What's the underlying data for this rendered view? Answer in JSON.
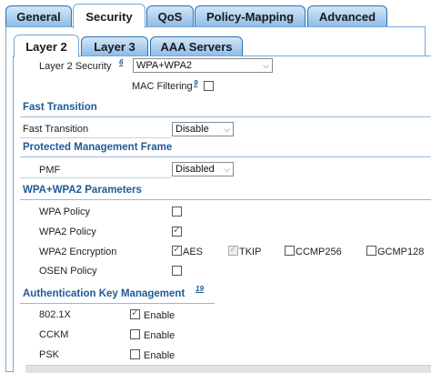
{
  "outer_tabs": [
    {
      "label": "General"
    },
    {
      "label": "Security",
      "active": true
    },
    {
      "label": "QoS"
    },
    {
      "label": "Policy-Mapping"
    },
    {
      "label": "Advanced"
    }
  ],
  "inner_tabs": [
    {
      "label": "Layer 2",
      "active": true
    },
    {
      "label": "Layer 3"
    },
    {
      "label": "AAA Servers"
    }
  ],
  "layer2": {
    "security_label": "Layer 2 Security",
    "security_help": "6",
    "security_value": "WPA+WPA2",
    "mac_filtering_label": "MAC Filtering",
    "mac_filtering_help": "9",
    "mac_filtering_checked": false
  },
  "fast_transition": {
    "heading": "Fast Transition",
    "label": "Fast Transition",
    "value": "Disable"
  },
  "pmf": {
    "heading": "Protected Management Frame",
    "label": "PMF",
    "value": "Disabled"
  },
  "wpa": {
    "heading": "WPA+WPA2 Parameters",
    "wpa_policy_label": "WPA Policy",
    "wpa_policy_checked": false,
    "wpa2_policy_label": "WPA2 Policy",
    "wpa2_policy_checked": true,
    "wpa2_encryption_label": "WPA2 Encryption",
    "encryptions": [
      {
        "label": "AES",
        "checked": true,
        "disabled": false
      },
      {
        "label": "TKIP",
        "checked": true,
        "disabled": true
      },
      {
        "label": "CCMP256",
        "checked": false,
        "disabled": false
      },
      {
        "label": "GCMP128",
        "checked": false,
        "disabled": false
      }
    ],
    "osen_label": "OSEN Policy",
    "osen_checked": false
  },
  "akm": {
    "heading": "Authentication Key Management",
    "help": "19",
    "rows": [
      {
        "label": "802.1X",
        "option": "Enable",
        "checked": true
      },
      {
        "label": "CCKM",
        "option": "Enable",
        "checked": false
      },
      {
        "label": "PSK",
        "option": "Enable",
        "checked": false
      }
    ]
  },
  "icons": {
    "dropdown": "chevron-down-icon",
    "check": "checkmark-icon"
  },
  "colors": {
    "tab_border": "#2c6fb2",
    "tab_gradient_top": "#d4e6f8",
    "tab_gradient_bottom": "#8ebde8",
    "section_heading": "#1f5a96"
  }
}
